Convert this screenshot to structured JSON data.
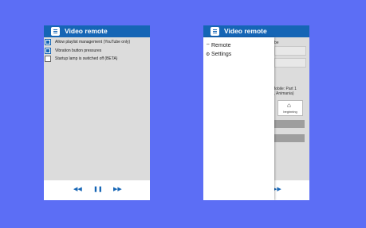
{
  "app": {
    "title": "Video remote"
  },
  "settings_screen": {
    "options": [
      {
        "label": "Allow playlist management (YouTube only)",
        "checked": true
      },
      {
        "label": "Vibration button pressures",
        "checked": true
      },
      {
        "label": "Startup lamp is switched off (BETA)",
        "checked": false
      }
    ],
    "controls": {
      "previous": "◀◀",
      "play_pause": "❚❚",
      "next": "▶▶"
    }
  },
  "drawer_screen": {
    "menu": [
      {
        "label": "Remote",
        "icon": "remote-icon"
      },
      {
        "label": "Settings",
        "icon": "gear-icon"
      }
    ],
    "background": {
      "fragment_1": "be",
      "fragment_2": "Mobile: Part 1",
      "fragment_3": "s, Animania)",
      "tile_label": "beginning",
      "next_control": "▶▶"
    }
  }
}
